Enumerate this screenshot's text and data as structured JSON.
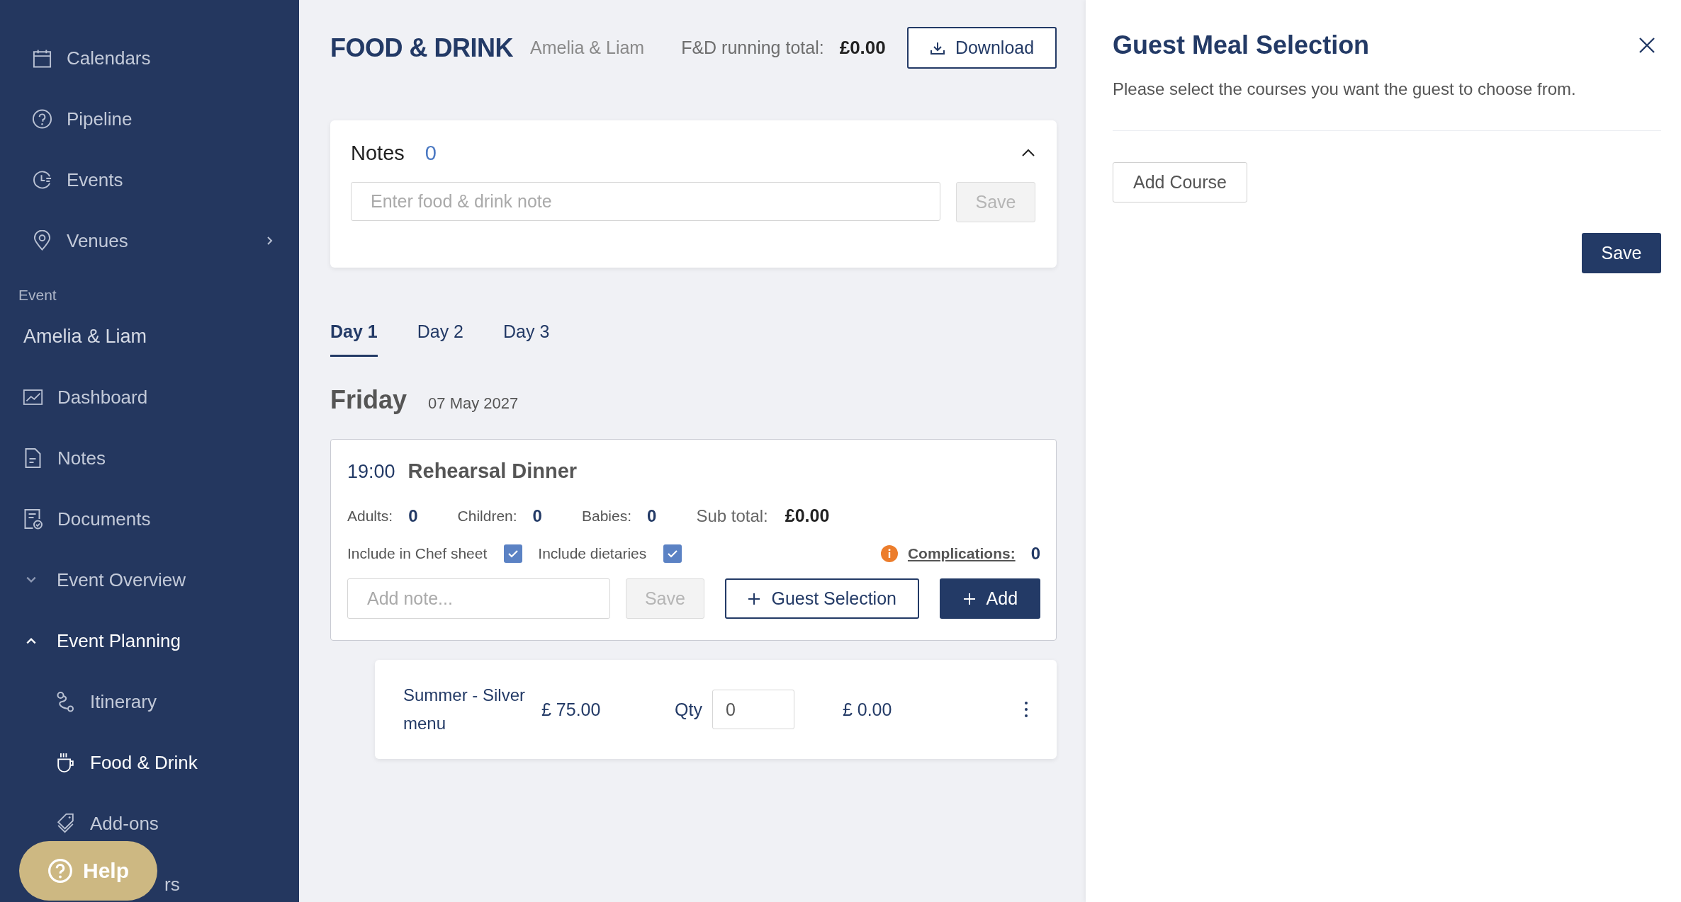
{
  "sidebar": {
    "items": [
      {
        "label": "Calendars",
        "expandable": false
      },
      {
        "label": "Pipeline",
        "expandable": false
      },
      {
        "label": "Events",
        "expandable": false
      },
      {
        "label": "Venues",
        "expandable": true
      }
    ],
    "section_label": "Event",
    "event_name": "Amelia & Liam",
    "event_items": [
      {
        "label": "Dashboard"
      },
      {
        "label": "Notes"
      },
      {
        "label": "Documents"
      }
    ],
    "groups": [
      {
        "label": "Event Overview",
        "expanded": false
      },
      {
        "label": "Event Planning",
        "expanded": true,
        "children": [
          {
            "label": "Itinerary",
            "selected": false
          },
          {
            "label": "Food & Drink",
            "selected": true
          },
          {
            "label": "Add-ons",
            "selected": false
          },
          {
            "label": "rs",
            "selected": false
          }
        ]
      }
    ],
    "help_button": "Help"
  },
  "header": {
    "title": "FOOD & DRINK",
    "event": "Amelia & Liam",
    "total_label": "F&D running total:",
    "total": "£0.00",
    "download_button": "Download"
  },
  "notes": {
    "title": "Notes",
    "count": "0",
    "expanded": true,
    "placeholder": "Enter food & drink note",
    "save_button": {
      "label": "Save",
      "disabled": true
    }
  },
  "tabs": [
    {
      "label": "Day 1",
      "selected": true
    },
    {
      "label": "Day 2",
      "selected": false
    },
    {
      "label": "Day 3",
      "selected": false
    }
  ],
  "day": {
    "name": "Friday",
    "date": "07 May 2027"
  },
  "event": {
    "time": "19:00",
    "name": "Rehearsal Dinner",
    "counts": [
      {
        "label": "Adults:",
        "value": "0"
      },
      {
        "label": "Children:",
        "value": "0"
      },
      {
        "label": "Babies:",
        "value": "0"
      }
    ],
    "subtotal_label": "Sub total:",
    "subtotal": "£0.00",
    "options": [
      {
        "label": "Include in Chef sheet",
        "checked": true
      },
      {
        "label": "Include dietaries",
        "checked": true
      }
    ],
    "complications_label": "Complications:",
    "complications": "0",
    "note_placeholder": "Add note...",
    "save_button": {
      "label": "Save",
      "disabled": true
    },
    "guest_selection_button": "Guest Selection",
    "add_button": "Add"
  },
  "menu_items": [
    {
      "name": "Summer - Silver menu",
      "price": "£ 75.00",
      "qty_label": "Qty",
      "qty": "0",
      "total": "£ 0.00"
    }
  ],
  "panel": {
    "title": "Guest Meal Selection",
    "description": "Please select the courses you want the guest to choose from.",
    "add_course_button": "Add Course",
    "save_button": "Save"
  }
}
